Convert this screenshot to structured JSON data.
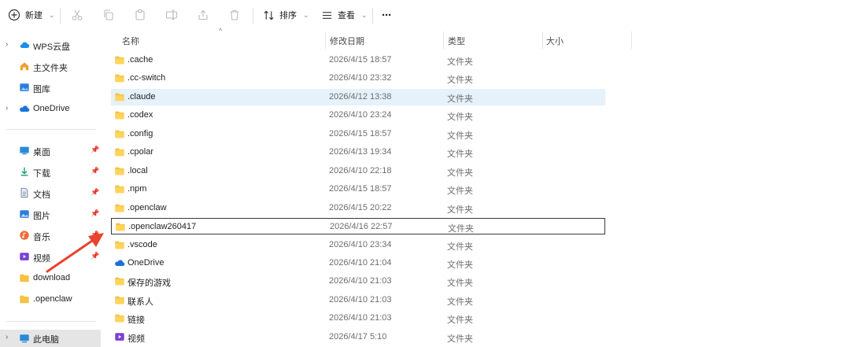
{
  "toolbar": {
    "new_label": "新建",
    "sort_label": "排序",
    "view_label": "查看",
    "more_label": "···"
  },
  "sidebar": {
    "items": [
      {
        "label": "WPS云盘",
        "icon": "cloud-icon"
      },
      {
        "label": "主文件夹",
        "icon": "home-icon"
      },
      {
        "label": "图库",
        "icon": "gallery-icon"
      },
      {
        "label": "OneDrive",
        "icon": "onedrive-icon"
      },
      {
        "label": "桌面",
        "icon": "desktop-icon"
      },
      {
        "label": "下载",
        "icon": "download-icon"
      },
      {
        "label": "文档",
        "icon": "document-icon"
      },
      {
        "label": "图片",
        "icon": "picture-icon"
      },
      {
        "label": "音乐",
        "icon": "music-icon"
      },
      {
        "label": "视频",
        "icon": "video-icon"
      },
      {
        "label": "download",
        "icon": "folder-icon"
      },
      {
        "label": ".openclaw",
        "icon": "folder-icon"
      },
      {
        "label": "此电脑",
        "icon": "computer-icon"
      }
    ]
  },
  "columns": {
    "name": "名称",
    "date": "修改日期",
    "type": "类型",
    "size": "大小"
  },
  "files": [
    {
      "name": ".cache",
      "date": "2026/4/15 18:57",
      "type": "文件夹",
      "icon": "folder-icon"
    },
    {
      "name": ".cc-switch",
      "date": "2026/4/10 23:32",
      "type": "文件夹",
      "icon": "folder-icon"
    },
    {
      "name": ".claude",
      "date": "2026/4/12 13:38",
      "type": "文件夹",
      "icon": "folder-icon"
    },
    {
      "name": ".codex",
      "date": "2026/4/10 23:24",
      "type": "文件夹",
      "icon": "folder-icon"
    },
    {
      "name": ".config",
      "date": "2026/4/15 18:57",
      "type": "文件夹",
      "icon": "folder-icon"
    },
    {
      "name": ".cpolar",
      "date": "2026/4/13 19:34",
      "type": "文件夹",
      "icon": "folder-icon"
    },
    {
      "name": ".local",
      "date": "2026/4/10 22:18",
      "type": "文件夹",
      "icon": "folder-icon"
    },
    {
      "name": ".npm",
      "date": "2026/4/15 18:57",
      "type": "文件夹",
      "icon": "folder-icon"
    },
    {
      "name": ".openclaw",
      "date": "2026/4/15 20:22",
      "type": "文件夹",
      "icon": "folder-icon"
    },
    {
      "name": ".openclaw260417",
      "date": "2026/4/16 22:57",
      "type": "文件夹",
      "icon": "folder-icon"
    },
    {
      "name": ".vscode",
      "date": "2026/4/10 23:34",
      "type": "文件夹",
      "icon": "folder-icon"
    },
    {
      "name": "OneDrive",
      "date": "2026/4/10 21:04",
      "type": "文件夹",
      "icon": "onedrive-icon"
    },
    {
      "name": "保存的游戏",
      "date": "2026/4/10 21:03",
      "type": "文件夹",
      "icon": "folder-icon"
    },
    {
      "name": "联系人",
      "date": "2026/4/10 21:03",
      "type": "文件夹",
      "icon": "folder-icon"
    },
    {
      "name": "链接",
      "date": "2026/4/10 21:03",
      "type": "文件夹",
      "icon": "folder-icon"
    },
    {
      "name": "视频",
      "date": "2026/4/17 5:10",
      "type": "文件夹",
      "icon": "video-icon"
    }
  ],
  "colors": {
    "folder": "#f5c242",
    "hover_row": "#e5f1fb",
    "annotation_arrow": "#e8432f",
    "onedrive": "#1a73d9"
  }
}
